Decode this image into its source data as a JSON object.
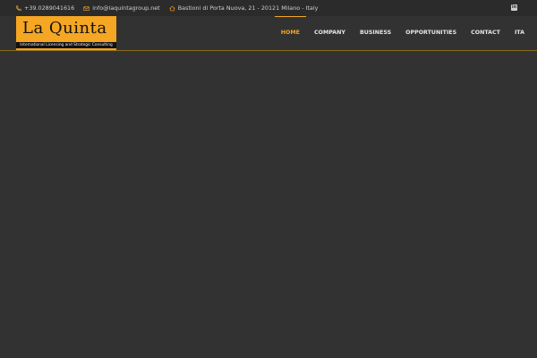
{
  "topbar": {
    "phone": "+39.0289041616",
    "email": "info@laquintagroup.net",
    "address": "Bastioni di Porta Nuova, 21 - 20121 Milano - Italy",
    "social_icon": "linkedin-icon"
  },
  "logo": {
    "name": "La Quinta",
    "tagline": "International Licensing and Strategic Consulting"
  },
  "nav": {
    "items": [
      {
        "label": "HOME"
      },
      {
        "label": "COMPANY"
      },
      {
        "label": "BUSINESS"
      },
      {
        "label": "OPPORTUNITIES"
      },
      {
        "label": "CONTACT"
      },
      {
        "label": "ITA"
      }
    ]
  },
  "colors": {
    "accent": "#f5a623",
    "background": "#323233",
    "topbar": "#2b2b2c"
  }
}
